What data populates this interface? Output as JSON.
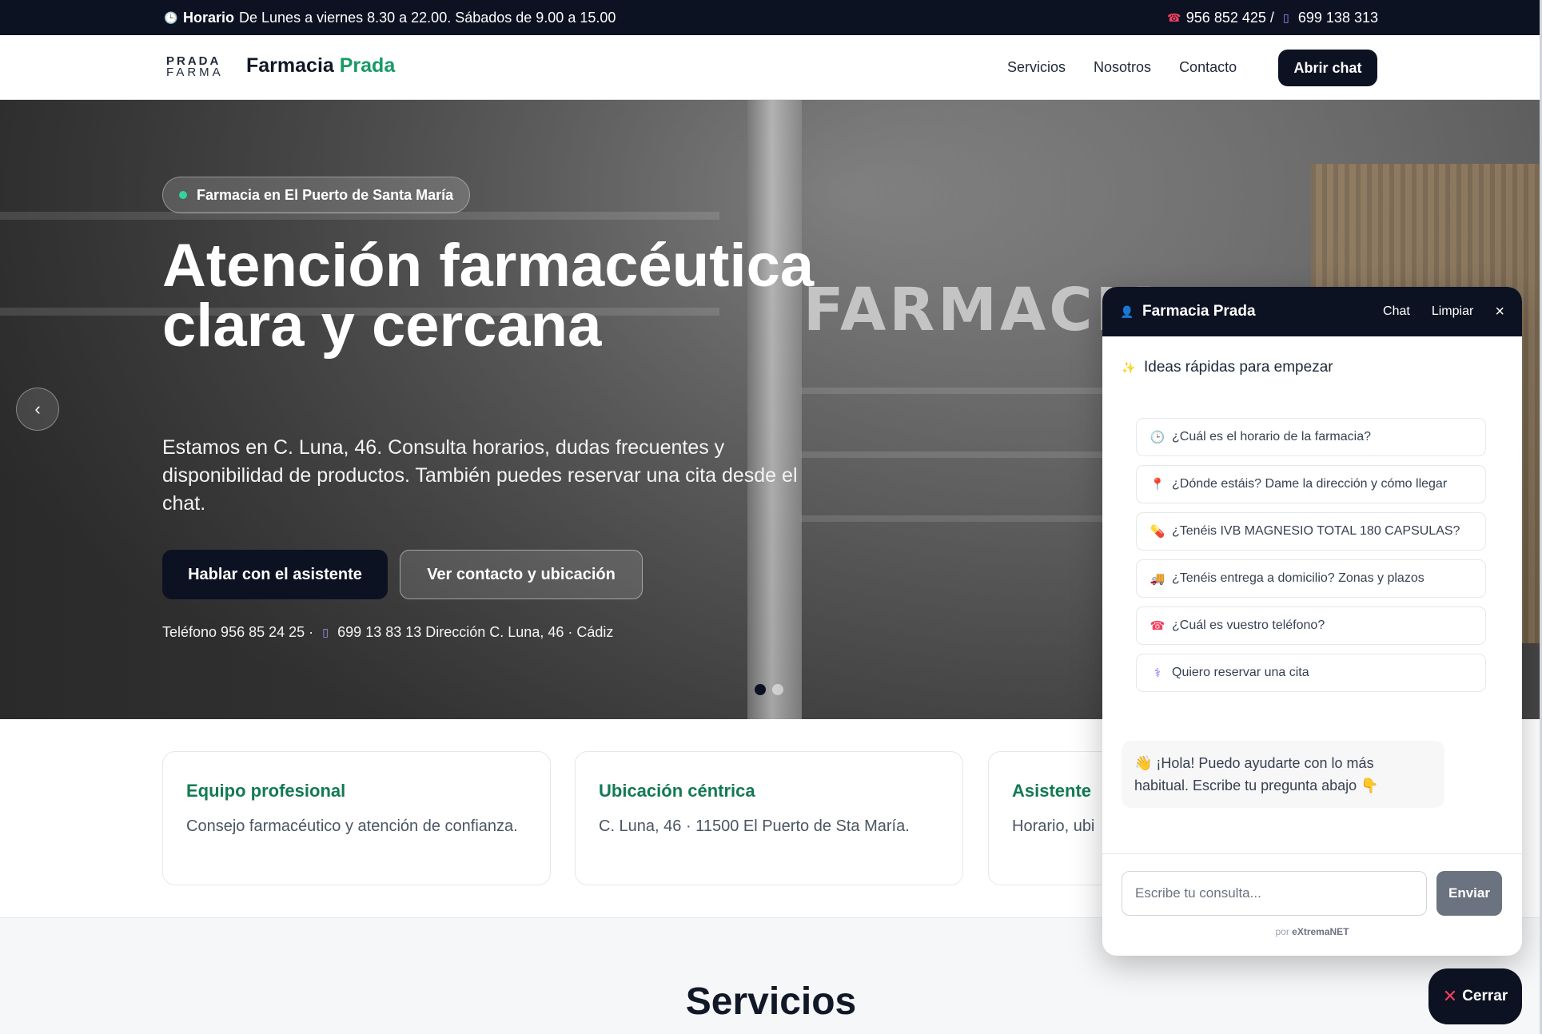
{
  "topbar": {
    "hours_label": "Horario",
    "hours_text": "De Lunes a viernes 8.30 a 22.00. Sábados de 9.00 a 15.00",
    "phone1": "956 852 425 /",
    "phone2": "699 138 313",
    "icons": [
      "clock-icon",
      "phone-icon",
      "mobile-icon"
    ]
  },
  "nav": {
    "logo_line1": "PRADA",
    "logo_line2": "FARMA",
    "brand_main": "Farmacia",
    "brand_accent": "Prada",
    "links": [
      "Servicios",
      "Nosotros",
      "Contacto"
    ],
    "cta": "Abrir chat",
    "accent_color": "#169a67"
  },
  "hero": {
    "badge": "Farmacia en El Puerto de Santa María",
    "title": "Atención farmacéutica clara y cercana",
    "description": "Estamos en C. Luna, 46. Consulta horarios, dudas frecuentes y disponibilidad de productos. También puedes reservar una cita desde el chat.",
    "btn_primary": "Hablar con el asistente",
    "btn_secondary": "Ver contacto y ubicación",
    "contact_line_1": "Teléfono 956 85 24 25 ·",
    "contact_line_2": "699 13 83 13 Dirección C. Luna, 46 · Cádiz",
    "sign_text": "FARMACIA I",
    "prev_arrow": "‹",
    "slides": 2,
    "active_slide": 1
  },
  "cards": [
    {
      "title": "Equipo profesional",
      "text": "Consejo farmacéutico y atención de confianza."
    },
    {
      "title": "Ubicación céntrica",
      "text": "C. Luna, 46 · 11500 El Puerto de Sta María."
    },
    {
      "title": "Asistente",
      "text": "Horario, ubi"
    }
  ],
  "section": {
    "title": "Servicios"
  },
  "chat": {
    "title": "Farmacia Prada",
    "action_chat": "Chat",
    "action_clear": "Limpiar",
    "close": "×",
    "ideas_title": "Ideas rápidas para empezar",
    "suggestions": [
      {
        "icon": "clock-icon",
        "glyph": "🕒",
        "text": "¿Cuál es el horario de la farmacia?"
      },
      {
        "icon": "pin-icon",
        "glyph": "📍",
        "text": "¿Dónde estáis? Dame la dirección y cómo llegar"
      },
      {
        "icon": "pill-icon",
        "glyph": "💊",
        "text": "¿Tenéis IVB MAGNESIO TOTAL 180 CAPSULAS?"
      },
      {
        "icon": "truck-icon",
        "glyph": "🚚",
        "text": "¿Tenéis entrega a domicilio? Zonas y plazos"
      },
      {
        "icon": "phone-icon",
        "glyph": "☎",
        "text": "¿Cuál es vuestro teléfono?"
      },
      {
        "icon": "stethoscope-icon",
        "glyph": "⚕",
        "text": "Quiero reservar una cita"
      }
    ],
    "greeting": "👋 ¡Hola! Puedo ayudarte con lo más habitual. Escribe tu pregunta abajo 👇",
    "input_placeholder": "Escribe tu consulta...",
    "send": "Enviar",
    "powered_prefix": "por",
    "powered_brand": "eXtremaNET"
  },
  "close_chat": "Cerrar"
}
